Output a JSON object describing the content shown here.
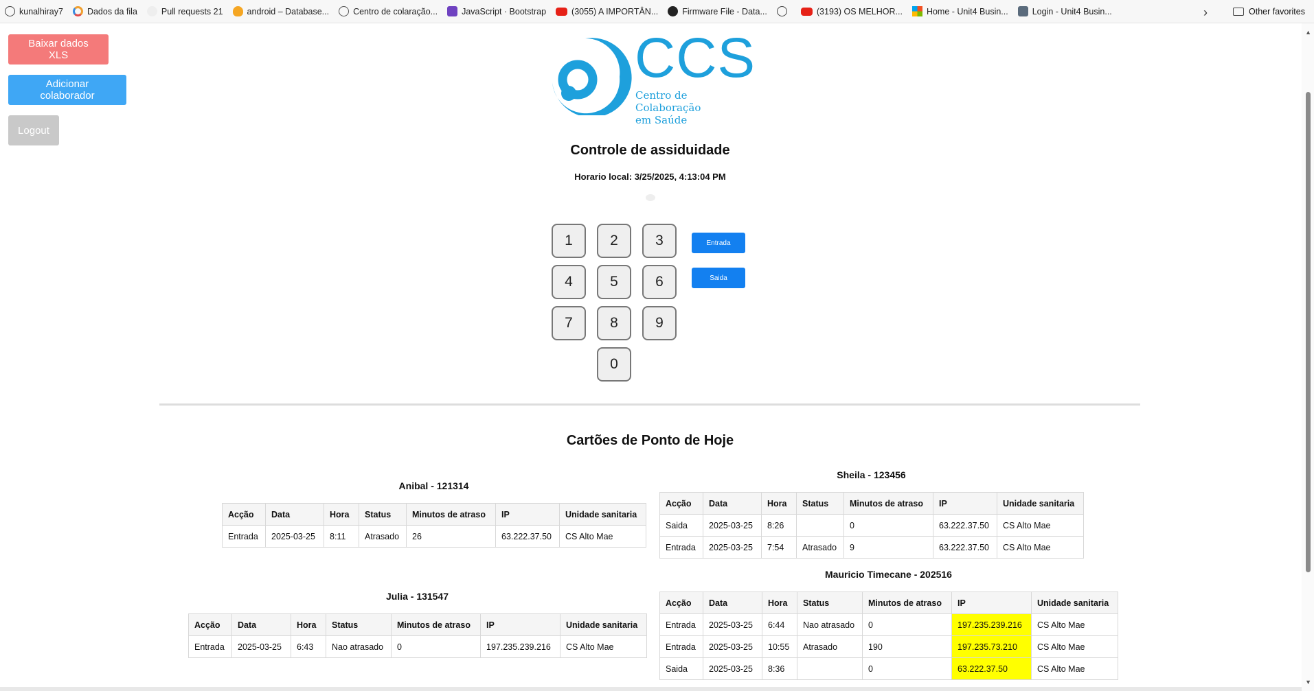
{
  "bookmarks": [
    {
      "label": "kunalhiray7",
      "icon": "globe"
    },
    {
      "label": "Dados da fila",
      "icon": "ring"
    },
    {
      "label": "Pull requests 21",
      "icon": "gh"
    },
    {
      "label": "android – Database...",
      "icon": "fire"
    },
    {
      "label": "Centro de colaração...",
      "icon": "clock"
    },
    {
      "label": "JavaScript · Bootstrap",
      "icon": "bs"
    },
    {
      "label": "(3055) A IMPORTÂN...",
      "icon": "yt"
    },
    {
      "label": "Firmware File - Data...",
      "icon": "fw"
    },
    {
      "label": "",
      "icon": "globe"
    },
    {
      "label": "(3193) OS MELHOR...",
      "icon": "yt"
    },
    {
      "label": "Home - Unit4 Busin...",
      "icon": "ms"
    },
    {
      "label": "Login - Unit4 Busin...",
      "icon": "u4"
    }
  ],
  "bookmarks_other": "Other favorites",
  "side": {
    "download_label": "Baixar dados XLS",
    "add_label": "Adicionar colaborador",
    "logout_label": "Logout"
  },
  "logo": {
    "big": "CCS",
    "line1": "Centro de Colaboração",
    "line2": "em Saúde"
  },
  "title": "Controle de assiduidade",
  "clock": "Horario local: 3/25/2025, 4:13:04 PM",
  "keypad": [
    "1",
    "2",
    "3",
    "4",
    "5",
    "6",
    "7",
    "8",
    "9",
    "0"
  ],
  "actions": {
    "entrada": "Entrada",
    "saida": "Saida"
  },
  "section_title": "Cartões de Ponto de Hoje",
  "headers": [
    "Acção",
    "Data",
    "Hora",
    "Status",
    "Minutos de atraso",
    "IP",
    "Unidade sanitaria"
  ],
  "cards": [
    {
      "title": "Anibal - 121314",
      "rows": [
        [
          "Entrada",
          "2025-03-25",
          "8:11",
          "Atrasado",
          "26",
          "63.222.37.50",
          "CS Alto Mae"
        ]
      ]
    },
    {
      "title": "Sheila - 123456",
      "rows": [
        [
          "Saida",
          "2025-03-25",
          "8:26",
          "",
          "0",
          "63.222.37.50",
          "CS Alto Mae"
        ],
        [
          "Entrada",
          "2025-03-25",
          "7:54",
          "Atrasado",
          "9",
          "63.222.37.50",
          "CS Alto Mae"
        ]
      ]
    },
    {
      "title": "Julia - 131547",
      "rows": [
        [
          "Entrada",
          "2025-03-25",
          "6:43",
          "Nao atrasado",
          "0",
          "197.235.239.216",
          "CS Alto Mae"
        ]
      ]
    },
    {
      "title": "Mauricio Timecane - 202516",
      "highlight_ip": true,
      "rows": [
        [
          "Entrada",
          "2025-03-25",
          "6:44",
          "Nao atrasado",
          "0",
          "197.235.239.216",
          "CS Alto Mae"
        ],
        [
          "Entrada",
          "2025-03-25",
          "10:55",
          "Atrasado",
          "190",
          "197.235.73.210",
          "CS Alto Mae"
        ],
        [
          "Saida",
          "2025-03-25",
          "8:36",
          "",
          "0",
          "63.222.37.50",
          "CS Alto Mae"
        ]
      ]
    }
  ],
  "colors": {
    "download": "#f47a7a",
    "add": "#3fa7f5",
    "logout": "#c9c9c9",
    "action": "#1380f0",
    "brand": "#1ea0dc",
    "ip_highlight": "#ffff00"
  }
}
